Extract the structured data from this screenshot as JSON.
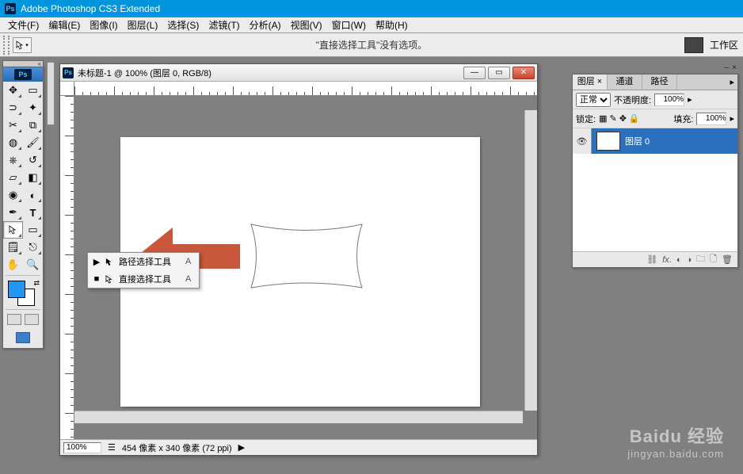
{
  "app": {
    "title": "Adobe Photoshop CS3 Extended",
    "logo": "Ps"
  },
  "menu": [
    "文件(F)",
    "编辑(E)",
    "图像(I)",
    "图层(L)",
    "选择(S)",
    "滤镜(T)",
    "分析(A)",
    "视图(V)",
    "窗口(W)",
    "帮助(H)"
  ],
  "options": {
    "message": "\"直接选择工具\"没有选项。",
    "workspace_label": "工作区"
  },
  "doc": {
    "title": "未标题-1 @ 100% (图层 0, RGB/8)",
    "zoom": "100%",
    "status": "454 像素 x 340 像素 (72 ppi)"
  },
  "flyout": {
    "items": [
      {
        "marker": "▶",
        "label": "路径选择工具",
        "shortcut": "A"
      },
      {
        "marker": "■",
        "label": "直接选择工具",
        "shortcut": "A"
      }
    ]
  },
  "layers_panel": {
    "tabs": [
      "图层 ×",
      "通道",
      "路径"
    ],
    "blend_mode": "正常",
    "opacity_label": "不透明度:",
    "opacity_value": "100%",
    "lock_label": "锁定:",
    "fill_label": "填充:",
    "fill_value": "100%",
    "layers": [
      {
        "name": "图层 0"
      }
    ]
  },
  "watermark": {
    "brand": "Baidu 经验",
    "url": "jingyan.baidu.com"
  }
}
